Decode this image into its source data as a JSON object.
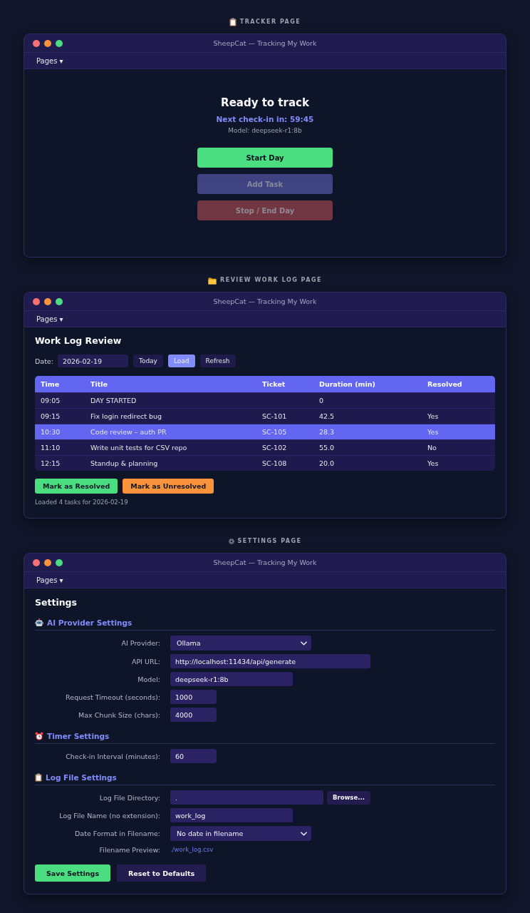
{
  "pages": [
    {
      "kind": "tracker",
      "caption": "TRACKER PAGE",
      "window": {
        "title": "SheepCat — Tracking My Work",
        "menu": "Pages ▾"
      },
      "status": "Ready to track",
      "countdown": "Next check-in in: 59:45",
      "model": "Model: deepseek-r1:8b",
      "buttons": [
        {
          "kind": "start",
          "label": "Start Day",
          "disabled": false
        },
        {
          "kind": "add",
          "label": "Add Task",
          "disabled": true
        },
        {
          "kind": "stop",
          "label": "Stop / End Day",
          "disabled": true
        }
      ]
    },
    {
      "kind": "review",
      "caption": "REVIEW WORK LOG PAGE",
      "window": {
        "title": "SheepCat — Tracking My Work",
        "menu": "Pages ▾"
      },
      "heading": "Work Log Review",
      "date": {
        "label": "Date:",
        "value": "2026-02-19"
      },
      "date_buttons": [
        {
          "label": "Today",
          "active": false
        },
        {
          "label": "Load",
          "active": true
        },
        {
          "label": "Refresh",
          "active": false
        }
      ],
      "table": {
        "columns": [
          "Time",
          "Title",
          "Ticket",
          "Duration (min)",
          "Resolved"
        ],
        "rows": [
          {
            "time": "09:05",
            "title": "DAY STARTED",
            "duration": "0",
            "selected": false
          },
          {
            "time": "09:15",
            "title": "Fix login redirect bug",
            "ticket": "SC-101",
            "duration": "42.5",
            "resolved": "Yes",
            "selected": false
          },
          {
            "time": "10:30",
            "title": "Code review – auth PR",
            "ticket": "SC-105",
            "duration": "28.3",
            "resolved": "Yes",
            "selected": true
          },
          {
            "time": "11:10",
            "title": "Write unit tests for CSV repo",
            "ticket": "SC-102",
            "duration": "55.0",
            "resolved": "No",
            "selected": false
          },
          {
            "time": "12:15",
            "title": "Standup & planning",
            "ticket": "SC-108",
            "duration": "20.0",
            "resolved": "Yes",
            "selected": false
          }
        ]
      },
      "actions": [
        {
          "kind": "resolve",
          "label": "Mark as Resolved"
        },
        {
          "kind": "unresolve",
          "label": "Mark as Unresolved"
        }
      ],
      "status": "Loaded 4 tasks for 2026-02-19"
    },
    {
      "kind": "settings",
      "caption": "SETTINGS PAGE",
      "window": {
        "title": "SheepCat — Tracking My Work",
        "menu": "Pages ▾"
      },
      "heading": "Settings",
      "sections": [
        {
          "kind": "ai_provider",
          "title": "AI Provider Settings",
          "fields": [
            {
              "kind": "select",
              "label": "AI Provider:",
              "value": "Ollama"
            },
            {
              "kind": "url",
              "label": "API URL:",
              "value": "http://localhost:11434/api/generate"
            },
            {
              "kind": "text",
              "label": "Model:",
              "value": "deepseek-r1:8b"
            },
            {
              "kind": "number",
              "label": "Request Timeout (seconds):",
              "value": "1000"
            },
            {
              "kind": "number",
              "label": "Max Chunk Size (chars):",
              "value": "4000"
            }
          ]
        },
        {
          "kind": "timer",
          "title": "Timer Settings",
          "fields": [
            {
              "kind": "number",
              "label": "Check-in Interval (minutes):",
              "value": "60"
            }
          ]
        },
        {
          "kind": "log_file",
          "title": "Log File Settings",
          "fields": [
            {
              "kind": "path",
              "label": "Log File Directory:",
              "value": ".",
              "button": "Browse..."
            },
            {
              "kind": "text",
              "label": "Log File Name (no extension):",
              "value": "work_log"
            },
            {
              "kind": "select",
              "label": "Date Format in Filename:",
              "value": "No date in filename"
            },
            {
              "kind": "preview",
              "label": "Filename Preview:",
              "value": "./work_log.csv"
            }
          ]
        }
      ],
      "buttons": [
        {
          "kind": "save",
          "label": "Save Settings"
        },
        {
          "kind": "reset",
          "label": "Reset to Defaults"
        }
      ]
    }
  ]
}
